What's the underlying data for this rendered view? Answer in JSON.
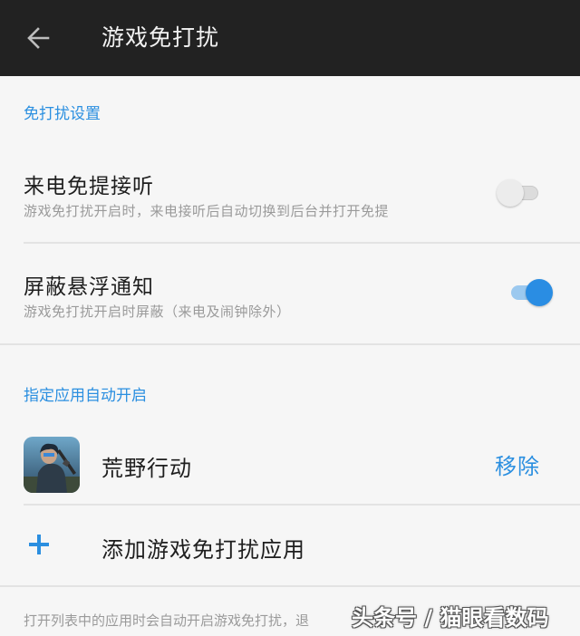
{
  "header": {
    "title": "游戏免打扰"
  },
  "sections": {
    "dnd_settings": {
      "header": "免打扰设置",
      "call_handsfree": {
        "title": "来电免提接听",
        "subtitle": "游戏免打扰开启时，来电接听后自动切换到后台并打开免提",
        "enabled": false
      },
      "block_floating": {
        "title": "屏蔽悬浮通知",
        "subtitle": "游戏免打扰开启时屏蔽（来电及闹钟除外）",
        "enabled": true
      }
    },
    "auto_apps": {
      "header": "指定应用自动开启",
      "apps": [
        {
          "name": "荒野行动",
          "action": "移除"
        }
      ],
      "add_label": "添加游戏免打扰应用"
    }
  },
  "footnote": "打开列表中的应用时会自动开启游戏免打扰，退",
  "watermark": "头条号 / 猫眼看数码",
  "colors": {
    "accent": "#2b8fe0",
    "toolbar": "#222222",
    "background": "#f6f6f6"
  }
}
